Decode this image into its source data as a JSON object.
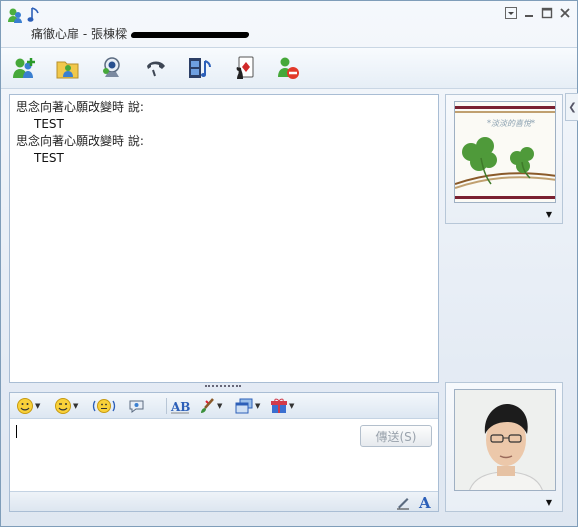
{
  "window": {
    "contact_status": "痛徹心扉",
    "separator": " - ",
    "contact_name": "張棟樑"
  },
  "toolbar": {
    "items": [
      {
        "name": "invite-contact",
        "icon": "add-contact-icon"
      },
      {
        "name": "send-files",
        "icon": "folder-share-icon"
      },
      {
        "name": "video-call",
        "icon": "webcam-icon"
      },
      {
        "name": "voice-call",
        "icon": "phone-icon"
      },
      {
        "name": "activities",
        "icon": "film-music-icon"
      },
      {
        "name": "games",
        "icon": "game-card-icon"
      },
      {
        "name": "block",
        "icon": "block-contact-icon"
      }
    ]
  },
  "conversation": {
    "messages": [
      {
        "sender": "思念向著心願改變時 說:",
        "text": "TEST"
      },
      {
        "sender": "思念向著心願改變時 說:",
        "text": "TEST"
      }
    ]
  },
  "compose": {
    "send_label": "傳送(S)",
    "text": ""
  },
  "colors": {
    "window_bg": "#e4ebf4",
    "border": "#a9bdd4",
    "clover": "#4f9a3a"
  }
}
